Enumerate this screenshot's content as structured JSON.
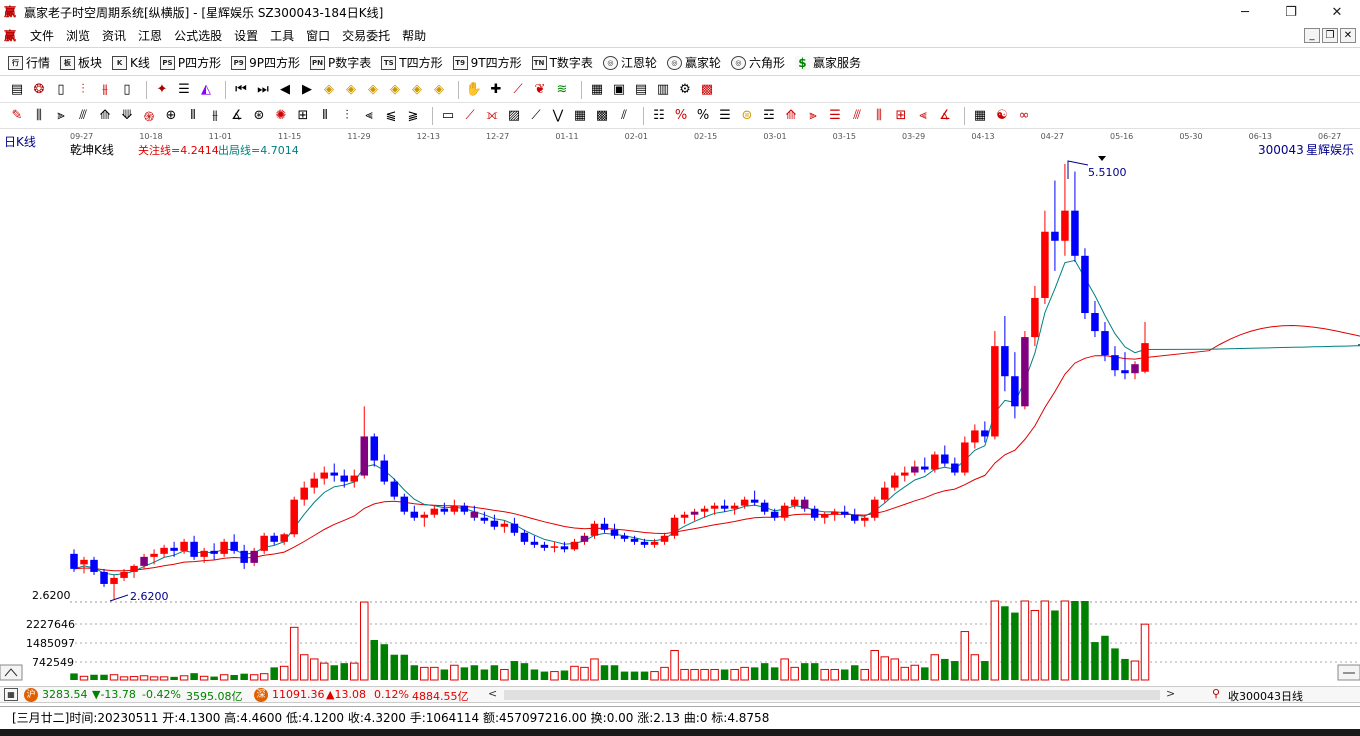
{
  "window": {
    "title": "赢家老子时空周期系统[纵横版] - [星辉娱乐   SZ300043-184日K线]",
    "minimize": "─",
    "maximize": "❐",
    "close": "✕",
    "logo": "赢"
  },
  "menu": [
    "文件",
    "浏览",
    "资讯",
    "江恩",
    "公式选股",
    "设置",
    "工具",
    "窗口",
    "交易委托",
    "帮助"
  ],
  "mdi": [
    "_",
    "❐",
    "✕"
  ],
  "toolbar1": [
    {
      "icon": "行",
      "label": "行情"
    },
    {
      "icon": "板",
      "label": "板块"
    },
    {
      "icon": "K",
      "label": "K线"
    },
    {
      "icon": "PS",
      "label": "P四方形"
    },
    {
      "icon": "P9",
      "label": "9P四方形"
    },
    {
      "icon": "PN",
      "label": "P数字表"
    },
    {
      "icon": "TS",
      "label": "T四方形"
    },
    {
      "icon": "T9",
      "label": "9T四方形"
    },
    {
      "icon": "TN",
      "label": "T数字表"
    },
    {
      "icon": "◎",
      "label": "江恩轮"
    },
    {
      "icon": "◎",
      "label": "赢家轮"
    },
    {
      "icon": "◎",
      "label": "六角形"
    },
    {
      "icon": "$",
      "label": "赢家服务"
    }
  ],
  "chart_header": {
    "period_label": "日K线",
    "indicator_name": "乾坤K线",
    "focus_line": "关注线=4.2414",
    "exit_line": "出局线=4.7014",
    "stock_code": "300043",
    "stock_name": "星辉娱乐"
  },
  "chart_data": {
    "type": "candlestick",
    "date_ticks": [
      "09-27",
      "10-18",
      "11-01",
      "11-15",
      "11-29",
      "12-13",
      "12-27",
      "01-11",
      "02-01",
      "02-15",
      "03-01",
      "03-15",
      "03-29",
      "04-13",
      "04-27",
      "05-16",
      "05-30",
      "06-13",
      "06-27"
    ],
    "price_low_label": "2.6200",
    "price_low_mark": "2.6200",
    "price_high_mark": "5.5100",
    "y_min": 2.62,
    "y_max": 5.51,
    "volume_ticks": [
      "2227646",
      "1485097",
      "742549"
    ],
    "candles": [
      {
        "o": 2.92,
        "h": 2.95,
        "l": 2.8,
        "c": 2.82
      },
      {
        "o": 2.85,
        "h": 2.9,
        "l": 2.79,
        "c": 2.88
      },
      {
        "o": 2.88,
        "h": 2.9,
        "l": 2.78,
        "c": 2.8
      },
      {
        "o": 2.8,
        "h": 2.82,
        "l": 2.7,
        "c": 2.72
      },
      {
        "o": 2.72,
        "h": 2.78,
        "l": 2.62,
        "c": 2.76
      },
      {
        "o": 2.76,
        "h": 2.82,
        "l": 2.74,
        "c": 2.8
      },
      {
        "o": 2.8,
        "h": 2.85,
        "l": 2.76,
        "c": 2.84
      },
      {
        "o": 2.84,
        "h": 2.92,
        "l": 2.82,
        "c": 2.9
      },
      {
        "o": 2.9,
        "h": 2.95,
        "l": 2.85,
        "c": 2.92
      },
      {
        "o": 2.92,
        "h": 2.98,
        "l": 2.9,
        "c": 2.96
      },
      {
        "o": 2.96,
        "h": 3.0,
        "l": 2.9,
        "c": 2.94
      },
      {
        "o": 2.94,
        "h": 3.02,
        "l": 2.92,
        "c": 3.0
      },
      {
        "o": 3.0,
        "h": 3.04,
        "l": 2.88,
        "c": 2.9
      },
      {
        "o": 2.9,
        "h": 2.96,
        "l": 2.86,
        "c": 2.94
      },
      {
        "o": 2.94,
        "h": 2.99,
        "l": 2.88,
        "c": 2.92
      },
      {
        "o": 2.92,
        "h": 3.02,
        "l": 2.9,
        "c": 3.0
      },
      {
        "o": 3.0,
        "h": 3.05,
        "l": 2.92,
        "c": 2.94
      },
      {
        "o": 2.94,
        "h": 2.98,
        "l": 2.82,
        "c": 2.86
      },
      {
        "o": 2.86,
        "h": 2.96,
        "l": 2.84,
        "c": 2.94
      },
      {
        "o": 2.94,
        "h": 3.06,
        "l": 2.92,
        "c": 3.04
      },
      {
        "o": 3.04,
        "h": 3.06,
        "l": 2.98,
        "c": 3.0
      },
      {
        "o": 3.0,
        "h": 3.06,
        "l": 2.98,
        "c": 3.05
      },
      {
        "o": 3.05,
        "h": 3.3,
        "l": 3.03,
        "c": 3.28
      },
      {
        "o": 3.28,
        "h": 3.4,
        "l": 3.24,
        "c": 3.36
      },
      {
        "o": 3.36,
        "h": 3.46,
        "l": 3.32,
        "c": 3.42
      },
      {
        "o": 3.42,
        "h": 3.5,
        "l": 3.38,
        "c": 3.46
      },
      {
        "o": 3.46,
        "h": 3.52,
        "l": 3.4,
        "c": 3.44
      },
      {
        "o": 3.44,
        "h": 3.48,
        "l": 3.36,
        "c": 3.4
      },
      {
        "o": 3.4,
        "h": 3.48,
        "l": 3.36,
        "c": 3.44
      },
      {
        "o": 3.44,
        "h": 3.9,
        "l": 3.42,
        "c": 3.7
      },
      {
        "o": 3.7,
        "h": 3.72,
        "l": 3.5,
        "c": 3.54
      },
      {
        "o": 3.54,
        "h": 3.58,
        "l": 3.38,
        "c": 3.4
      },
      {
        "o": 3.4,
        "h": 3.42,
        "l": 3.28,
        "c": 3.3
      },
      {
        "o": 3.3,
        "h": 3.32,
        "l": 3.18,
        "c": 3.2
      },
      {
        "o": 3.2,
        "h": 3.24,
        "l": 3.14,
        "c": 3.16
      },
      {
        "o": 3.16,
        "h": 3.2,
        "l": 3.1,
        "c": 3.18
      },
      {
        "o": 3.18,
        "h": 3.24,
        "l": 3.16,
        "c": 3.22
      },
      {
        "o": 3.22,
        "h": 3.26,
        "l": 3.18,
        "c": 3.2
      },
      {
        "o": 3.2,
        "h": 3.28,
        "l": 3.18,
        "c": 3.24
      },
      {
        "o": 3.24,
        "h": 3.26,
        "l": 3.18,
        "c": 3.2
      },
      {
        "o": 3.2,
        "h": 3.24,
        "l": 3.14,
        "c": 3.16
      },
      {
        "o": 3.16,
        "h": 3.2,
        "l": 3.12,
        "c": 3.14
      },
      {
        "o": 3.14,
        "h": 3.18,
        "l": 3.08,
        "c": 3.1
      },
      {
        "o": 3.1,
        "h": 3.14,
        "l": 3.06,
        "c": 3.12
      },
      {
        "o": 3.12,
        "h": 3.16,
        "l": 3.04,
        "c": 3.06
      },
      {
        "o": 3.06,
        "h": 3.08,
        "l": 2.98,
        "c": 3.0
      },
      {
        "o": 3.0,
        "h": 3.04,
        "l": 2.96,
        "c": 2.98
      },
      {
        "o": 2.98,
        "h": 3.0,
        "l": 2.94,
        "c": 2.96
      },
      {
        "o": 2.96,
        "h": 3.0,
        "l": 2.93,
        "c": 2.97
      },
      {
        "o": 2.97,
        "h": 3.0,
        "l": 2.93,
        "c": 2.95
      },
      {
        "o": 2.95,
        "h": 3.02,
        "l": 2.94,
        "c": 3.0
      },
      {
        "o": 3.0,
        "h": 3.06,
        "l": 2.98,
        "c": 3.04
      },
      {
        "o": 3.04,
        "h": 3.14,
        "l": 3.02,
        "c": 3.12
      },
      {
        "o": 3.12,
        "h": 3.16,
        "l": 3.06,
        "c": 3.08
      },
      {
        "o": 3.08,
        "h": 3.12,
        "l": 3.02,
        "c": 3.04
      },
      {
        "o": 3.04,
        "h": 3.06,
        "l": 3.0,
        "c": 3.02
      },
      {
        "o": 3.02,
        "h": 3.04,
        "l": 2.98,
        "c": 3.0
      },
      {
        "o": 3.0,
        "h": 3.02,
        "l": 2.96,
        "c": 2.98
      },
      {
        "o": 2.98,
        "h": 3.02,
        "l": 2.96,
        "c": 3.0
      },
      {
        "o": 3.0,
        "h": 3.06,
        "l": 2.98,
        "c": 3.04
      },
      {
        "o": 3.04,
        "h": 3.18,
        "l": 3.02,
        "c": 3.16
      },
      {
        "o": 3.16,
        "h": 3.2,
        "l": 3.12,
        "c": 3.18
      },
      {
        "o": 3.18,
        "h": 3.22,
        "l": 3.14,
        "c": 3.2
      },
      {
        "o": 3.2,
        "h": 3.24,
        "l": 3.16,
        "c": 3.22
      },
      {
        "o": 3.22,
        "h": 3.26,
        "l": 3.18,
        "c": 3.24
      },
      {
        "o": 3.24,
        "h": 3.28,
        "l": 3.2,
        "c": 3.22
      },
      {
        "o": 3.22,
        "h": 3.26,
        "l": 3.18,
        "c": 3.24
      },
      {
        "o": 3.24,
        "h": 3.3,
        "l": 3.22,
        "c": 3.28
      },
      {
        "o": 3.28,
        "h": 3.34,
        "l": 3.24,
        "c": 3.26
      },
      {
        "o": 3.26,
        "h": 3.28,
        "l": 3.18,
        "c": 3.2
      },
      {
        "o": 3.2,
        "h": 3.22,
        "l": 3.14,
        "c": 3.16
      },
      {
        "o": 3.16,
        "h": 3.26,
        "l": 3.14,
        "c": 3.24
      },
      {
        "o": 3.24,
        "h": 3.3,
        "l": 3.22,
        "c": 3.28
      },
      {
        "o": 3.28,
        "h": 3.3,
        "l": 3.2,
        "c": 3.22
      },
      {
        "o": 3.22,
        "h": 3.24,
        "l": 3.14,
        "c": 3.16
      },
      {
        "o": 3.16,
        "h": 3.2,
        "l": 3.12,
        "c": 3.18
      },
      {
        "o": 3.18,
        "h": 3.22,
        "l": 3.14,
        "c": 3.2
      },
      {
        "o": 3.2,
        "h": 3.24,
        "l": 3.16,
        "c": 3.18
      },
      {
        "o": 3.18,
        "h": 3.22,
        "l": 3.12,
        "c": 3.14
      },
      {
        "o": 3.14,
        "h": 3.18,
        "l": 3.1,
        "c": 3.16
      },
      {
        "o": 3.16,
        "h": 3.3,
        "l": 3.14,
        "c": 3.28
      },
      {
        "o": 3.28,
        "h": 3.4,
        "l": 3.26,
        "c": 3.36
      },
      {
        "o": 3.36,
        "h": 3.46,
        "l": 3.34,
        "c": 3.44
      },
      {
        "o": 3.44,
        "h": 3.5,
        "l": 3.4,
        "c": 3.46
      },
      {
        "o": 3.46,
        "h": 3.54,
        "l": 3.44,
        "c": 3.5
      },
      {
        "o": 3.5,
        "h": 3.56,
        "l": 3.46,
        "c": 3.48
      },
      {
        "o": 3.48,
        "h": 3.6,
        "l": 3.46,
        "c": 3.58
      },
      {
        "o": 3.58,
        "h": 3.64,
        "l": 3.5,
        "c": 3.52
      },
      {
        "o": 3.52,
        "h": 3.56,
        "l": 3.44,
        "c": 3.46
      },
      {
        "o": 3.46,
        "h": 3.7,
        "l": 3.44,
        "c": 3.66
      },
      {
        "o": 3.66,
        "h": 3.78,
        "l": 3.62,
        "c": 3.74
      },
      {
        "o": 3.74,
        "h": 3.8,
        "l": 3.66,
        "c": 3.7
      },
      {
        "o": 3.7,
        "h": 4.4,
        "l": 3.68,
        "c": 4.3
      },
      {
        "o": 4.3,
        "h": 4.5,
        "l": 4.0,
        "c": 4.1
      },
      {
        "o": 4.1,
        "h": 4.26,
        "l": 3.82,
        "c": 3.9
      },
      {
        "o": 3.9,
        "h": 4.4,
        "l": 3.88,
        "c": 4.36
      },
      {
        "o": 4.36,
        "h": 4.7,
        "l": 4.3,
        "c": 4.62
      },
      {
        "o": 4.62,
        "h": 5.2,
        "l": 4.58,
        "c": 5.06
      },
      {
        "o": 5.06,
        "h": 5.4,
        "l": 4.8,
        "c": 5.0
      },
      {
        "o": 5.0,
        "h": 5.51,
        "l": 4.9,
        "c": 5.2
      },
      {
        "o": 5.2,
        "h": 5.46,
        "l": 4.86,
        "c": 4.9
      },
      {
        "o": 4.9,
        "h": 4.95,
        "l": 4.48,
        "c": 4.52
      },
      {
        "o": 4.52,
        "h": 4.6,
        "l": 4.36,
        "c": 4.4
      },
      {
        "o": 4.4,
        "h": 4.46,
        "l": 4.2,
        "c": 4.24
      },
      {
        "o": 4.24,
        "h": 4.3,
        "l": 4.1,
        "c": 4.14
      },
      {
        "o": 4.14,
        "h": 4.26,
        "l": 4.08,
        "c": 4.12
      },
      {
        "o": 4.12,
        "h": 4.2,
        "l": 4.08,
        "c": 4.18
      },
      {
        "o": 4.13,
        "h": 4.46,
        "l": 4.12,
        "c": 4.32
      }
    ],
    "series": [
      {
        "name": "关注线",
        "color": "#e00000"
      },
      {
        "name": "出局线",
        "color": "#008080"
      }
    ]
  },
  "index_bar": {
    "sh_value": "3283.54",
    "sh_change": "▼-13.78",
    "sh_pct": "-0.42%",
    "sh_amount": "3595.08亿",
    "sz_badge": "深",
    "sz_value": "11091.36",
    "sz_change": "▲13.08",
    "sz_pct": "0.12%",
    "sz_amount": "4884.55亿",
    "right_label": "收300043日线",
    "scroll_left": "<",
    "scroll_right": ">"
  },
  "status": {
    "lunar": "[三月廿二]",
    "text": "时间:20230511 开:4.1300 高:4.4600 低:4.1200 收:4.3200 手:1064114 额:457097216.00 换:0.00 涨:2.13 曲:0 标:4.8758"
  },
  "colors": {
    "up": "#ff0000",
    "down": "#0000ff",
    "volume_up": "#e00000",
    "volume_down": "#008000",
    "pivot": "#800080",
    "focus_line": "#e00000",
    "exit_line": "#008080"
  }
}
